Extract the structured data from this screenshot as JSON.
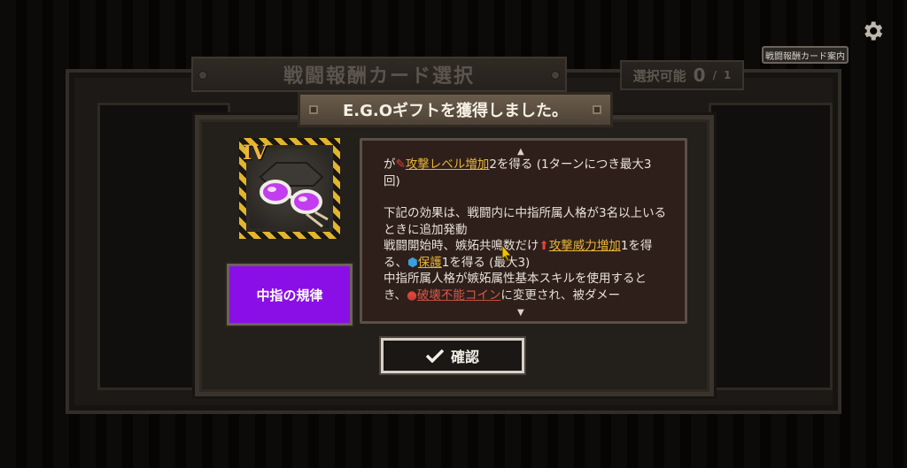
{
  "header": {
    "screen_title": "戦闘報酬カード選択",
    "selectable_label": "選択可能",
    "selectable_count": "0",
    "selectable_max": "1",
    "guide_button": "戦闘報酬カード案内"
  },
  "dialog": {
    "title": "E.G.Oギフトを獲得しました。",
    "gift": {
      "tier": "IV",
      "name": "中指の規律",
      "name_color": "#8a0fe6"
    },
    "description": {
      "lines": [
        {
          "pre": "が",
          "kw": "攻撃レベル増加",
          "post": "2を得る (1ターンにつき最大3回)"
        },
        {
          "text": "下記の効果は、戦闘内に中指所属人格が3名以上いるときに追加発動"
        },
        {
          "pre": "戦闘開始時、嫉妬共鳴数だけ",
          "kw": "攻撃威力増加",
          "post": "1を得る、"
        },
        {
          "kw": "保護",
          "post": "1を得る (最大3)"
        },
        {
          "text": "中指所属人格が嫉妬属性基本スキルを使用するとき、"
        },
        {
          "kw": "破壊不能コイン",
          "post": "に変更され、被ダメー"
        }
      ]
    },
    "confirm_button": "確認"
  },
  "icons": {
    "settings": "gear-icon",
    "confirm": "checkmark-icon",
    "scroll_up": "triangle-up-icon",
    "scroll_down": "triangle-down-icon"
  },
  "colors": {
    "keyword": "#e6b43a",
    "hazard_stripe": "#e2b52c"
  }
}
